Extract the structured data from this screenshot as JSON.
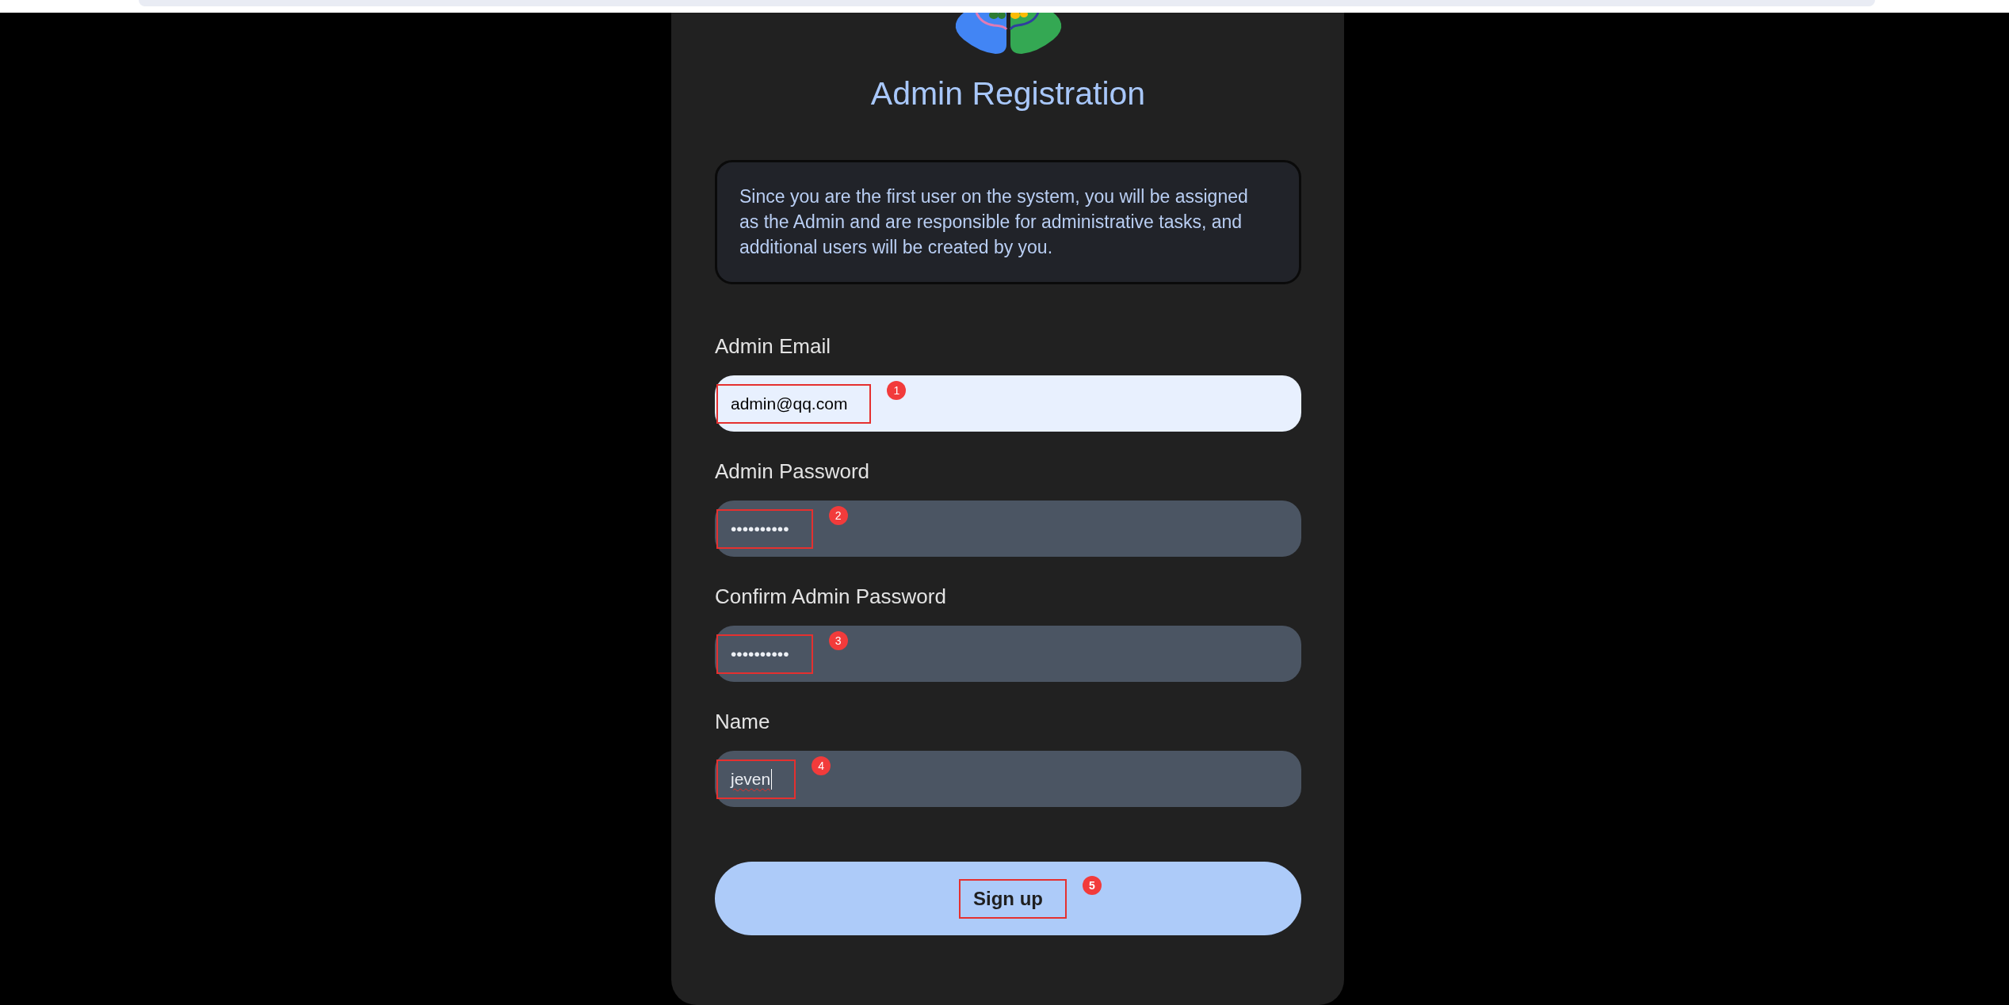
{
  "header": {
    "title": "Admin Registration"
  },
  "notice": {
    "text": "Since you are the first user on the system, you will be assigned as the Admin and are responsible for administrative tasks, and additional users will be created by you."
  },
  "fields": [
    {
      "label": "Admin Email",
      "value": "admin@qq.com",
      "autofilled": true,
      "focused": false,
      "misspelled": false,
      "callout": "1"
    },
    {
      "label": "Admin Password",
      "value": "••••••••••",
      "autofilled": false,
      "focused": false,
      "misspelled": false,
      "callout": "2"
    },
    {
      "label": "Confirm Admin Password",
      "value": "••••••••••",
      "autofilled": false,
      "focused": false,
      "misspelled": false,
      "callout": "3"
    },
    {
      "label": "Name",
      "value": "jeven",
      "autofilled": false,
      "focused": true,
      "misspelled": true,
      "callout": "4"
    }
  ],
  "submit": {
    "label": "Sign up",
    "callout": "5"
  }
}
